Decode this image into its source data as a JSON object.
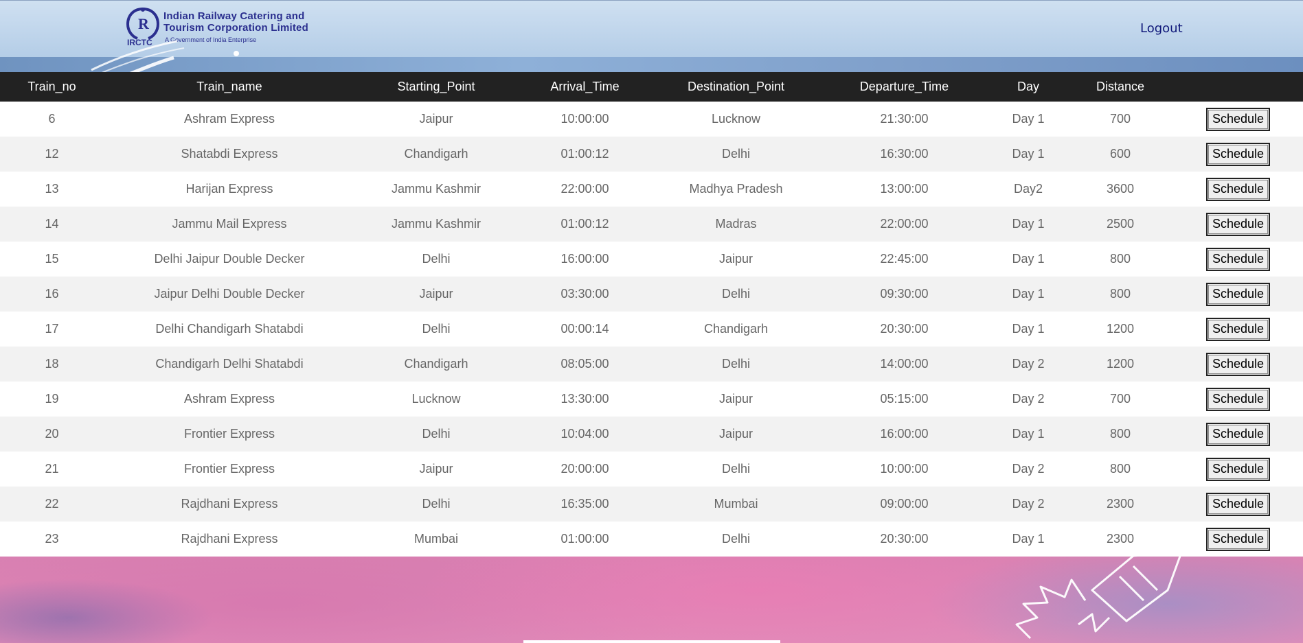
{
  "header": {
    "logo_abbr": "IRCTC",
    "logo_name": "Indian Railway Catering and Tourism Corporation Limited",
    "logo_sub": "A Government of India Enterprise",
    "logout_label": "Logout"
  },
  "table": {
    "columns": [
      "Train_no",
      "Train_name",
      "Starting_Point",
      "Arrival_Time",
      "Destination_Point",
      "Departure_Time",
      "Day",
      "Distance",
      ""
    ],
    "action_label": "Schedule",
    "rows": [
      [
        "6",
        "Ashram Express",
        "Jaipur",
        "10:00:00",
        "Lucknow",
        "21:30:00",
        "Day 1",
        "700"
      ],
      [
        "12",
        "Shatabdi Express",
        "Chandigarh",
        "01:00:12",
        "Delhi",
        "16:30:00",
        "Day 1",
        "600"
      ],
      [
        "13",
        "Harijan Express",
        "Jammu Kashmir",
        "22:00:00",
        "Madhya Pradesh",
        "13:00:00",
        "Day2",
        "3600"
      ],
      [
        "14",
        "Jammu Mail Express",
        "Jammu Kashmir",
        "01:00:12",
        "Madras",
        "22:00:00",
        "Day 1",
        "2500"
      ],
      [
        "15",
        "Delhi Jaipur Double Decker",
        "Delhi",
        "16:00:00",
        "Jaipur",
        "22:45:00",
        "Day 1",
        "800"
      ],
      [
        "16",
        "Jaipur Delhi Double Decker",
        "Jaipur",
        "03:30:00",
        "Delhi",
        "09:30:00",
        "Day 1",
        "800"
      ],
      [
        "17",
        "Delhi Chandigarh Shatabdi",
        "Delhi",
        "00:00:14",
        "Chandigarh",
        "20:30:00",
        "Day 1",
        "1200"
      ],
      [
        "18",
        "Chandigarh Delhi Shatabdi",
        "Chandigarh",
        "08:05:00",
        "Delhi",
        "14:00:00",
        "Day 2",
        "1200"
      ],
      [
        "19",
        "Ashram Express",
        "Lucknow",
        "13:30:00",
        "Jaipur",
        "05:15:00",
        "Day 2",
        "700"
      ],
      [
        "20",
        "Frontier Express",
        "Delhi",
        "10:04:00",
        "Jaipur",
        "16:00:00",
        "Day 1",
        "800"
      ],
      [
        "21",
        "Frontier Express",
        "Jaipur",
        "20:00:00",
        "Delhi",
        "10:00:00",
        "Day 2",
        "800"
      ],
      [
        "22",
        "Rajdhani Express",
        "Delhi",
        "16:35:00",
        "Mumbai",
        "09:00:00",
        "Day 2",
        "2300"
      ],
      [
        "23",
        "Rajdhani Express",
        "Mumbai",
        "01:00:00",
        "Delhi",
        "20:30:00",
        "Day 1",
        "2300"
      ]
    ]
  }
}
